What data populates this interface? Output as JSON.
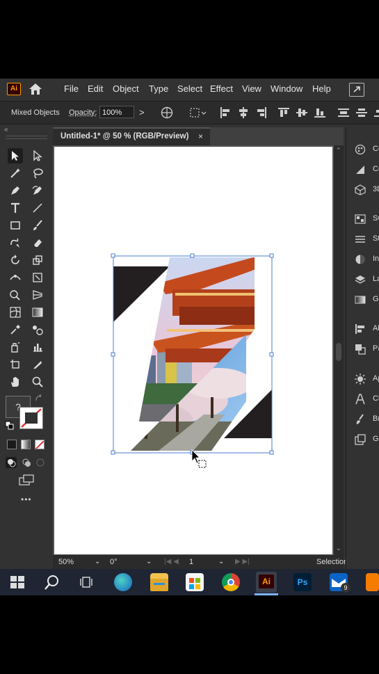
{
  "menubar": {
    "logo": "Ai",
    "items": [
      "File",
      "Edit",
      "Object",
      "Type",
      "Select",
      "Effect",
      "View",
      "Window",
      "Help"
    ]
  },
  "controlbar": {
    "selection_label": "Mixed Objects",
    "opacity_label": "Opacity:",
    "opacity_value": "100%",
    "more_glyph": ">"
  },
  "document": {
    "tab_title": "Untitled-1* @ 50 % (RGB/Preview)",
    "close_glyph": "×"
  },
  "toolbar": {
    "collapse_glyph": "«",
    "unknown_fill_glyph": "?",
    "more_tools_glyph": "•••"
  },
  "status": {
    "zoom": "50%",
    "rotation": "0°",
    "artboard_number": "1",
    "tool_name": "Selection"
  },
  "right_panel": {
    "items": [
      {
        "icon": "color-icon",
        "label": "Co"
      },
      {
        "icon": "color-guide-icon",
        "label": "Co"
      },
      {
        "icon": "3d-icon",
        "label": "3D"
      },
      {
        "icon": "swatches-icon",
        "label": "Sw"
      },
      {
        "icon": "stroke-icon",
        "label": "St"
      },
      {
        "icon": "image-trace-icon",
        "label": "In"
      },
      {
        "icon": "layers-icon",
        "label": "La"
      },
      {
        "icon": "gradient-icon",
        "label": "Gr"
      },
      {
        "icon": "align-icon",
        "label": "Al"
      },
      {
        "icon": "pathfinder-icon",
        "label": "Pa"
      },
      {
        "icon": "appearance-icon",
        "label": "Ap"
      },
      {
        "icon": "character-icon",
        "label": "Ch"
      },
      {
        "icon": "brushes-icon",
        "label": "Br"
      },
      {
        "icon": "graphic-styles-icon",
        "label": "Gr"
      }
    ]
  },
  "taskbar": {
    "mail_badge": "9"
  },
  "colors": {
    "ui_bg": "#323232",
    "accent": "#ff9a00",
    "selection_blue": "#4a7bd0",
    "artwork_black": "#231f20"
  }
}
